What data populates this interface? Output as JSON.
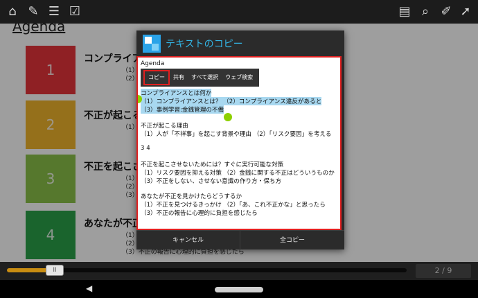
{
  "topbar": {
    "icons_left": [
      "home-icon",
      "pen-list-icon",
      "list-icon",
      "checklist-icon"
    ],
    "icons_right": [
      "slides-icon",
      "search-icon",
      "brush-icon",
      "forward-icon"
    ]
  },
  "page": {
    "title": "Agenda",
    "slides": [
      {
        "num": "1",
        "title": "コンプライアン",
        "lines": [
          "（1）",
          "（2）"
        ]
      },
      {
        "num": "2",
        "title": "不正が起こる",
        "lines": [
          "（1）"
        ]
      },
      {
        "num": "3",
        "title": "不正を起こさ",
        "lines": [
          "（1）",
          "（2）",
          "（3）"
        ]
      },
      {
        "num": "4",
        "title": "あなたが不正",
        "lines": [
          "（1）",
          "（2）",
          "（3）不正の報告に心理的に負担を感じたら"
        ]
      }
    ],
    "colors": {
      "slide1": "#e7353a",
      "slide2": "#f1b52c",
      "slide3": "#8cc24a",
      "slide4": "#2aa24a"
    }
  },
  "dialog": {
    "title": "テキストのコピー",
    "agenda_label": "Agenda",
    "context_menu": [
      "コピー",
      "共有",
      "すべて選択",
      "ウェブ検索"
    ],
    "lines": [
      "コンプライアンスとは何か",
      "（1）コンプライアンスとは？ （2）コンプライアンス違反があると",
      "（3）事例学習:金銭管理の不備",
      "不正が起こる理由",
      "（1）人が「不祥事」を起こす背景や理由 （2）「リスク要因」を考える",
      "3 4",
      "不正を起こさせないためには？すぐに実行可能な対策",
      "（1）リスク要因を抑える対策 （2）金銭に関する不正はどういうものか",
      "（3）不正をしない、させない意識の作り方・保ち方",
      "あなたが不正を見かけたらどうするか",
      "（1）不正を見つけるきっかけ （2）「あ、これ不正かな」と思ったら",
      "（3）不正の報告に心理的に負担を感じたら"
    ],
    "cancel_label": "キャンセル",
    "copy_all_label": "全コピー",
    "accent": "#33b5e5"
  },
  "bottombar": {
    "thumb_label": "II",
    "progress": 0.12,
    "page_indicator": "2 / 9"
  }
}
